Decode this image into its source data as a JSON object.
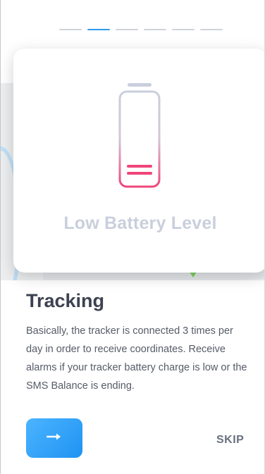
{
  "pager": {
    "total": 6,
    "active_index": 1
  },
  "card": {
    "icon": "low-battery-icon",
    "title": "Low Battery Level"
  },
  "content": {
    "heading": "Tracking",
    "description": "Basically, the tracker is connected 3 times per day in order to receive coordinates. Receive alarms if your tracker battery charge is low or the SMS Balance is ending."
  },
  "actions": {
    "next_icon": "arrow-right-icon",
    "skip_label": "SKIP"
  },
  "colors": {
    "accent": "#2e9bf0",
    "battery_low": "#f0457a",
    "battery_outline": "#c9cfdc"
  }
}
